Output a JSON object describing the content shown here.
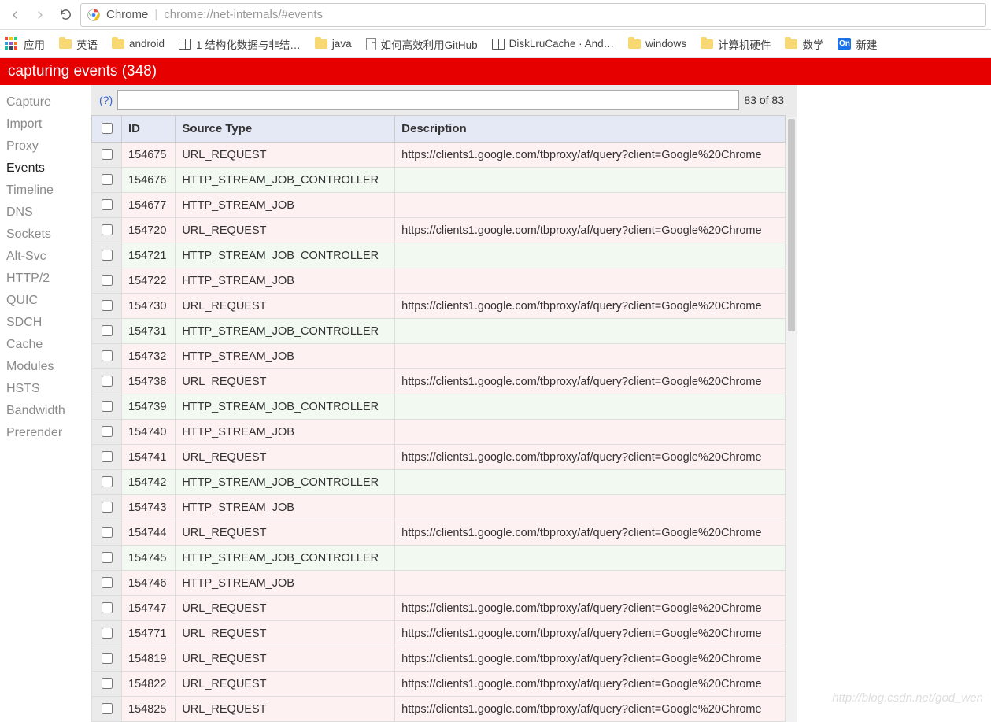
{
  "browser": {
    "label": "Chrome",
    "url": "chrome://net-internals/#events"
  },
  "bookmarks": [
    {
      "icon": "apps",
      "label": "应用"
    },
    {
      "icon": "folder",
      "label": "英语"
    },
    {
      "icon": "folder",
      "label": "android"
    },
    {
      "icon": "book",
      "label": "1 结构化数据与非结…"
    },
    {
      "icon": "folder",
      "label": "java"
    },
    {
      "icon": "page",
      "label": "如何高效利用GitHub"
    },
    {
      "icon": "book",
      "label": "DiskLruCache · And…"
    },
    {
      "icon": "folder",
      "label": "windows"
    },
    {
      "icon": "folder",
      "label": "计算机硬件"
    },
    {
      "icon": "folder",
      "label": "数学"
    },
    {
      "icon": "on",
      "label": "新建"
    }
  ],
  "banner": "capturing events (348)",
  "sidebar": [
    "Capture",
    "Import",
    "Proxy",
    "Events",
    "Timeline",
    "DNS",
    "Sockets",
    "Alt-Svc",
    "HTTP/2",
    "QUIC",
    "SDCH",
    "Cache",
    "Modules",
    "HSTS",
    "Bandwidth",
    "Prerender"
  ],
  "sidebar_active": "Events",
  "search": {
    "help": "(?)",
    "value": "",
    "count": "83 of 83"
  },
  "columns": {
    "id": "ID",
    "source": "Source Type",
    "desc": "Description"
  },
  "url_common": "https://clients1.google.com/tbproxy/af/query?client=Google%20Chrome",
  "rows": [
    {
      "id": "154675",
      "type": "URL_REQUEST",
      "kind": "pink",
      "has_desc": true
    },
    {
      "id": "154676",
      "type": "HTTP_STREAM_JOB_CONTROLLER",
      "kind": "green",
      "has_desc": false
    },
    {
      "id": "154677",
      "type": "HTTP_STREAM_JOB",
      "kind": "pink",
      "has_desc": false
    },
    {
      "id": "154720",
      "type": "URL_REQUEST",
      "kind": "pink",
      "has_desc": true
    },
    {
      "id": "154721",
      "type": "HTTP_STREAM_JOB_CONTROLLER",
      "kind": "green",
      "has_desc": false
    },
    {
      "id": "154722",
      "type": "HTTP_STREAM_JOB",
      "kind": "pink",
      "has_desc": false
    },
    {
      "id": "154730",
      "type": "URL_REQUEST",
      "kind": "pink",
      "has_desc": true
    },
    {
      "id": "154731",
      "type": "HTTP_STREAM_JOB_CONTROLLER",
      "kind": "green",
      "has_desc": false
    },
    {
      "id": "154732",
      "type": "HTTP_STREAM_JOB",
      "kind": "pink",
      "has_desc": false
    },
    {
      "id": "154738",
      "type": "URL_REQUEST",
      "kind": "pink",
      "has_desc": true
    },
    {
      "id": "154739",
      "type": "HTTP_STREAM_JOB_CONTROLLER",
      "kind": "green",
      "has_desc": false
    },
    {
      "id": "154740",
      "type": "HTTP_STREAM_JOB",
      "kind": "pink",
      "has_desc": false
    },
    {
      "id": "154741",
      "type": "URL_REQUEST",
      "kind": "pink",
      "has_desc": true
    },
    {
      "id": "154742",
      "type": "HTTP_STREAM_JOB_CONTROLLER",
      "kind": "green",
      "has_desc": false
    },
    {
      "id": "154743",
      "type": "HTTP_STREAM_JOB",
      "kind": "pink",
      "has_desc": false
    },
    {
      "id": "154744",
      "type": "URL_REQUEST",
      "kind": "pink",
      "has_desc": true
    },
    {
      "id": "154745",
      "type": "HTTP_STREAM_JOB_CONTROLLER",
      "kind": "green",
      "has_desc": false
    },
    {
      "id": "154746",
      "type": "HTTP_STREAM_JOB",
      "kind": "pink",
      "has_desc": false
    },
    {
      "id": "154747",
      "type": "URL_REQUEST",
      "kind": "pink",
      "has_desc": true
    },
    {
      "id": "154771",
      "type": "URL_REQUEST",
      "kind": "pink",
      "has_desc": true
    },
    {
      "id": "154819",
      "type": "URL_REQUEST",
      "kind": "pink",
      "has_desc": true
    },
    {
      "id": "154822",
      "type": "URL_REQUEST",
      "kind": "pink",
      "has_desc": true
    },
    {
      "id": "154825",
      "type": "URL_REQUEST",
      "kind": "pink",
      "has_desc": true
    }
  ],
  "watermark": "http://blog.csdn.net/god_wen"
}
